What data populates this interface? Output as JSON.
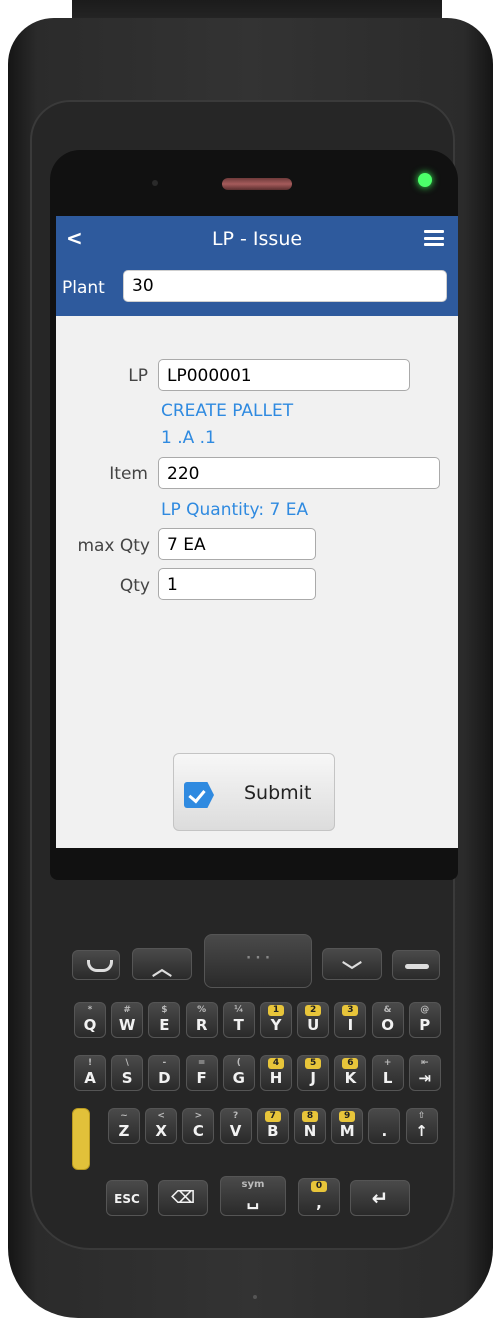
{
  "header": {
    "title": "LP - Issue"
  },
  "plant": {
    "label": "Plant",
    "value": "30"
  },
  "form": {
    "lp_label": "LP",
    "lp_value": "LP000001",
    "create_pallet": "CREATE PALLET",
    "location": "1 .A  .1",
    "item_label": "Item",
    "item_value": "220",
    "lp_quantity": "LP Quantity: 7 EA",
    "max_qty_label": "max Qty",
    "max_qty_value": "7 EA",
    "qty_label": "Qty",
    "qty_value": "1"
  },
  "actions": {
    "submit_label": "Submit"
  },
  "keypad": {
    "row1": [
      {
        "ch": "Q",
        "sub": "*"
      },
      {
        "ch": "W",
        "sub": "#"
      },
      {
        "ch": "E",
        "sub": "$"
      },
      {
        "ch": "R",
        "sub": "%"
      },
      {
        "ch": "T",
        "sub": "¼"
      },
      {
        "ch": "Y",
        "sub": "1",
        "yellow": true
      },
      {
        "ch": "U",
        "sub": "2",
        "yellow": true
      },
      {
        "ch": "I",
        "sub": "3",
        "yellow": true
      },
      {
        "ch": "O",
        "sub": "&"
      },
      {
        "ch": "P",
        "sub": "@"
      }
    ],
    "row2": [
      {
        "ch": "A",
        "sub": "!"
      },
      {
        "ch": "S",
        "sub": "\\"
      },
      {
        "ch": "D",
        "sub": "-"
      },
      {
        "ch": "F",
        "sub": "="
      },
      {
        "ch": "G",
        "sub": "("
      },
      {
        "ch": "H",
        "sub": "4",
        "yellow": true
      },
      {
        "ch": "J",
        "sub": "5",
        "yellow": true
      },
      {
        "ch": "K",
        "sub": "6",
        "yellow": true
      },
      {
        "ch": "L",
        "sub": "+"
      },
      {
        "ch": "⇥",
        "sub": "⇤"
      }
    ],
    "row3": [
      {
        "ch": "Z",
        "sub": "~"
      },
      {
        "ch": "X",
        "sub": "<"
      },
      {
        "ch": "C",
        "sub": ">"
      },
      {
        "ch": "V",
        "sub": "?"
      },
      {
        "ch": "B",
        "sub": "7",
        "yellow": true
      },
      {
        "ch": "N",
        "sub": "8",
        "yellow": true
      },
      {
        "ch": "M",
        "sub": "9",
        "yellow": true
      },
      {
        "ch": ".",
        "sub": ""
      },
      {
        "ch": "↑",
        "sub": "⇧"
      }
    ],
    "row4": {
      "esc": "ESC",
      "sym": "sym",
      "zero_sub": "0",
      "zero_ch": ","
    }
  },
  "colors": {
    "accent": "#2e5a9d",
    "link": "#2f8ae0",
    "led": "#4cff6a"
  }
}
